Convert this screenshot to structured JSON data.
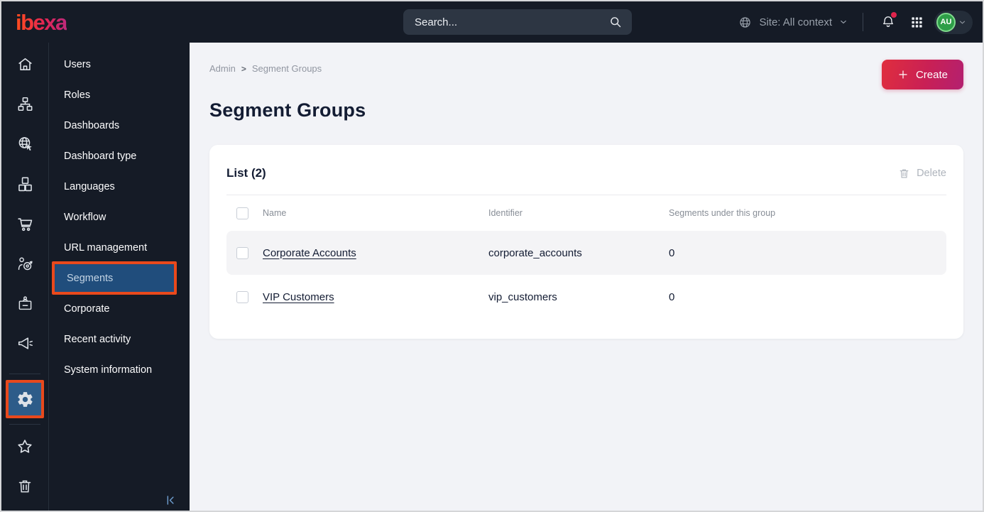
{
  "colors": {
    "topbar_bg": "#151b26",
    "annotation_red": "#e9491c",
    "active_menu_blue": "#204d7c",
    "active_rail_blue": "#2d5c89",
    "brand_gradient": [
      "#ff4a22",
      "#bd2a7c"
    ],
    "create_gradient": [
      "#e02e3e",
      "#b32070"
    ],
    "avatar_green": "#2e9e48",
    "notification_dot": "#e0244c"
  },
  "topbar": {
    "logo_text": "ibexa",
    "search_placeholder": "Search...",
    "site_label": "Site: All context",
    "avatar_initials": "AU"
  },
  "sidebar_icons": [
    "home",
    "content-tree",
    "site",
    "product-catalog",
    "commerce",
    "personalization",
    "corporate",
    "campaigns",
    "settings",
    "bookmarks",
    "trash"
  ],
  "menu": {
    "items": [
      "Users",
      "Roles",
      "Dashboards",
      "Dashboard type",
      "Languages",
      "Workflow",
      "URL management",
      "Segments",
      "Corporate",
      "Recent activity",
      "System information"
    ],
    "active_item": "Segments"
  },
  "main": {
    "breadcrumb": {
      "items": [
        "Admin",
        "Segment Groups"
      ],
      "separator": ">"
    },
    "title": "Segment Groups",
    "create_label": "Create",
    "card": {
      "title": "List (2)",
      "delete_label": "Delete",
      "table": {
        "headers": [
          "Name",
          "Identifier",
          "Segments under this group"
        ],
        "rows": [
          {
            "name": "Corporate Accounts",
            "identifier": "corporate_accounts",
            "segments": "0"
          },
          {
            "name": "VIP Customers",
            "identifier": "vip_customers",
            "segments": "0"
          }
        ]
      }
    }
  }
}
